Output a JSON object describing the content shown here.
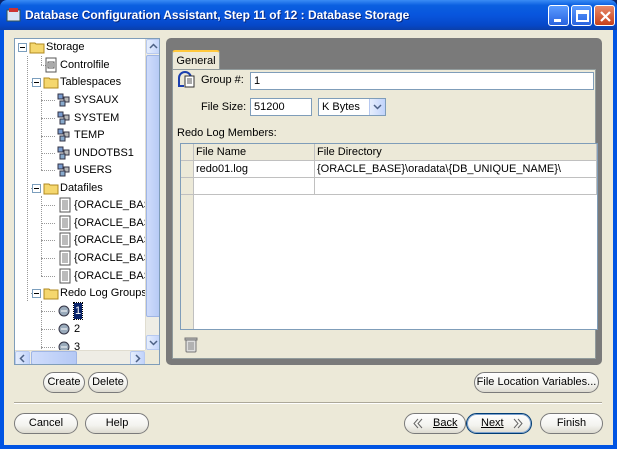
{
  "window": {
    "title": "Database Configuration Assistant, Step 11 of 12 : Database Storage"
  },
  "tree": {
    "items": [
      {
        "label": "Storage",
        "icon": "folder-icon"
      },
      {
        "label": "Controlfile",
        "icon": "controlfile-icon"
      },
      {
        "label": "Tablespaces",
        "icon": "folder-icon"
      },
      {
        "label": "SYSAUX",
        "icon": "tablespace-icon"
      },
      {
        "label": "SYSTEM",
        "icon": "tablespace-icon"
      },
      {
        "label": "TEMP",
        "icon": "tablespace-icon"
      },
      {
        "label": "UNDOTBS1",
        "icon": "tablespace-icon"
      },
      {
        "label": "USERS",
        "icon": "tablespace-icon"
      },
      {
        "label": "Datafiles",
        "icon": "folder-icon"
      },
      {
        "label": "{ORACLE_BASE",
        "icon": "datafile-icon"
      },
      {
        "label": "{ORACLE_BASE",
        "icon": "datafile-icon"
      },
      {
        "label": "{ORACLE_BASE",
        "icon": "datafile-icon"
      },
      {
        "label": "{ORACLE_BASE",
        "icon": "datafile-icon"
      },
      {
        "label": "{ORACLE_BASE",
        "icon": "datafile-icon"
      },
      {
        "label": "Redo Log Groups",
        "icon": "folder-icon"
      },
      {
        "label": "1",
        "icon": "redo-log-icon"
      },
      {
        "label": "2",
        "icon": "redo-log-icon"
      },
      {
        "label": "3",
        "icon": "redo-log-icon"
      }
    ]
  },
  "tree_buttons": {
    "create": "Create",
    "delete": "Delete"
  },
  "tab": {
    "label": "General"
  },
  "form": {
    "group_label": "Group #:",
    "group_value": "1",
    "file_size_label": "File Size:",
    "file_size_value": "51200",
    "unit_value": "K Bytes",
    "members_label": "Redo Log Members:"
  },
  "grid": {
    "columns": [
      "File Name",
      "File Directory"
    ],
    "rows": [
      [
        "redo01.log",
        "{ORACLE_BASE}\\oradata\\{DB_UNIQUE_NAME}\\"
      ],
      [
        "",
        ""
      ]
    ]
  },
  "file_location_button": "File Location Variables...",
  "footer": {
    "cancel": "Cancel",
    "help": "Help",
    "back": "Back",
    "next": "Next",
    "finish": "Finish"
  }
}
